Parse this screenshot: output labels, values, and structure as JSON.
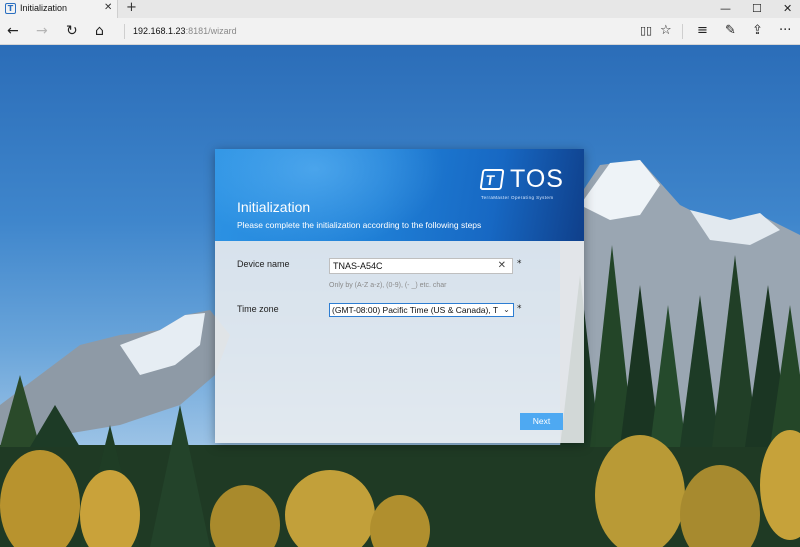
{
  "browser": {
    "tab": {
      "title": "Initialization",
      "favicon": "terramaster-tos-icon"
    },
    "new_tab_label": "+",
    "window_controls": {
      "minimize": "—",
      "maximize": "☐",
      "close": "✕"
    },
    "url": {
      "host": "192.168.1.23",
      "path": ":8181/wizard"
    },
    "icons": {
      "back": "←",
      "forward": "→",
      "refresh": "↻",
      "home": "⌂",
      "reading_view": "📖",
      "favorite": "☆",
      "hub": "≡",
      "web_note": "✎",
      "share": "⇪",
      "more": "···"
    }
  },
  "dialog": {
    "title": "Initialization",
    "subtitle": "Please complete the initialization according to the following steps",
    "logo": {
      "mark": "T",
      "text": "TOS",
      "tagline": "TerraMaster Operating System"
    },
    "device_name": {
      "label": "Device name",
      "value": "TNAS-A54C",
      "hint": "Only by (A-Z a-z), (0-9), (- _) etc. char",
      "required_mark": "*",
      "clear_icon": "✕"
    },
    "time_zone": {
      "label": "Time zone",
      "value": "(GMT-08:00) Pacific Time (US & Canada), T",
      "required_mark": "*",
      "arrow_icon": "⌄"
    },
    "next_label": "Next"
  },
  "colors": {
    "header_blue": "#1f7fd6",
    "next_button": "#4ea9f2",
    "select_focus_border": "#2d7dd2"
  }
}
